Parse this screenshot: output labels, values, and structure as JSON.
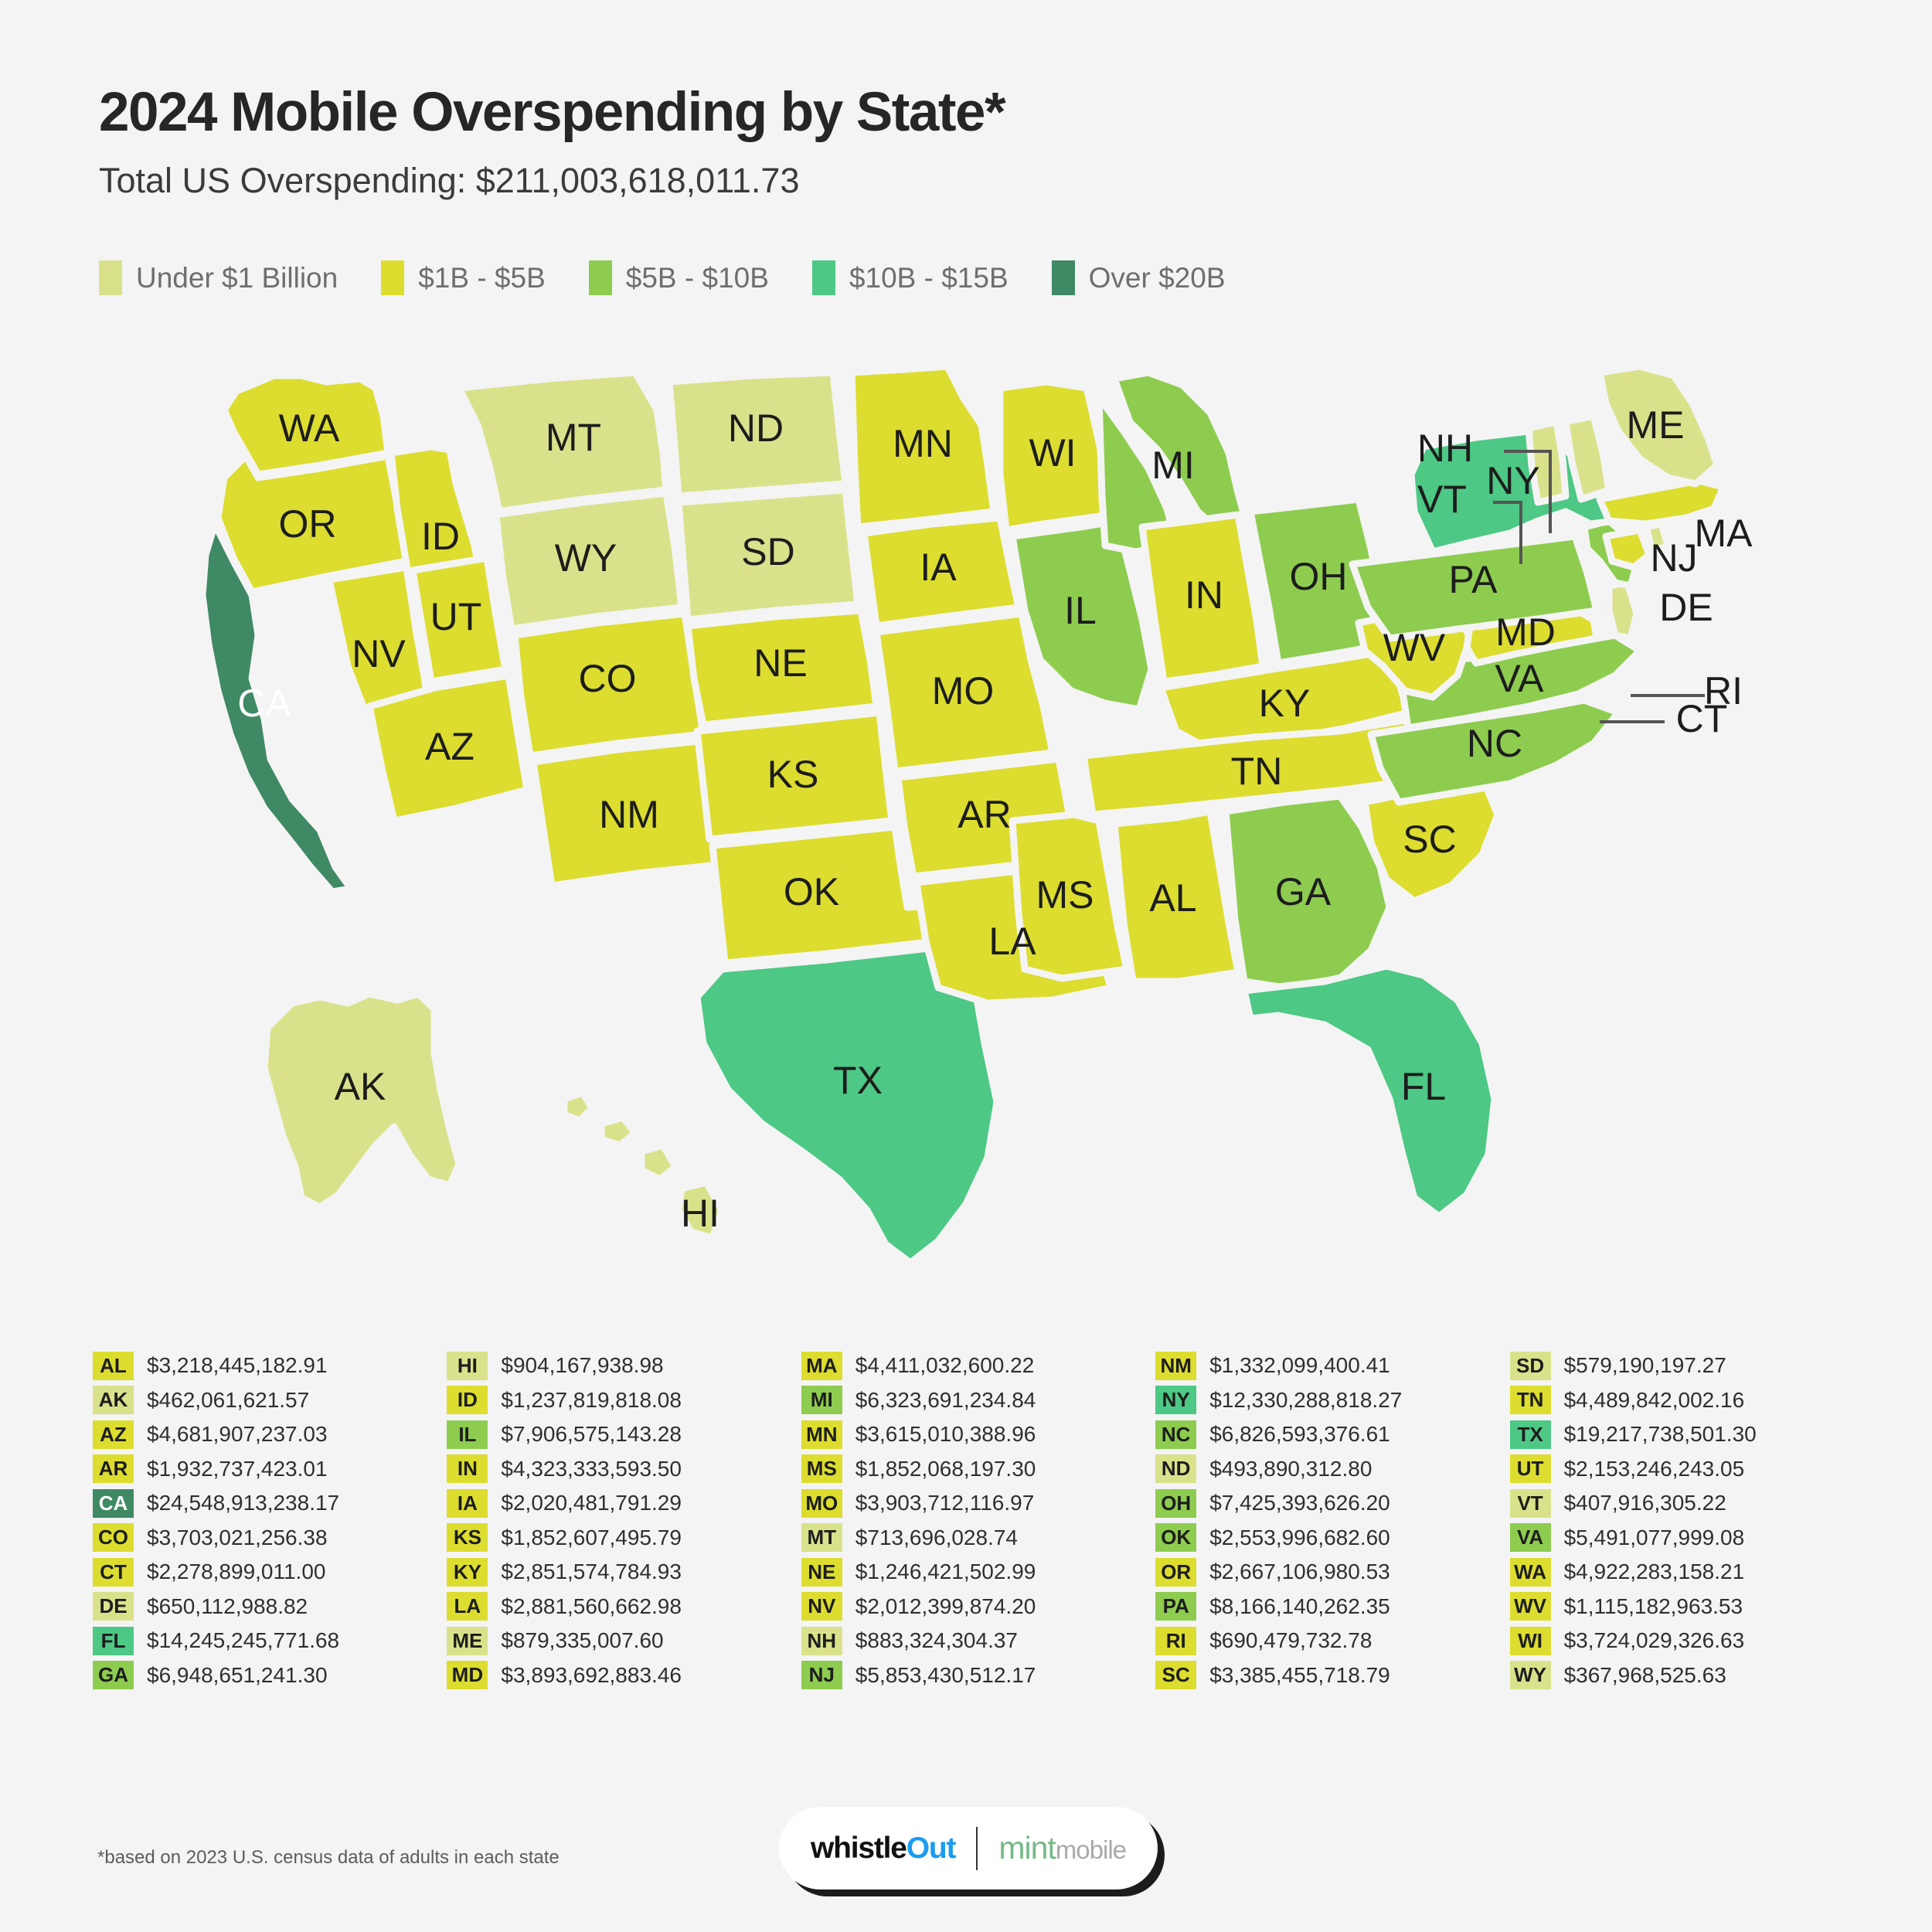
{
  "header": {
    "title": "2024 Mobile Overspending by State*",
    "subtitle": "Total US Overspending: $211,003,618,011.73"
  },
  "legend": {
    "items": [
      {
        "label": "Under $1 Billion",
        "color": "#d9e28b"
      },
      {
        "label": "$1B - $5B",
        "color": "#dcdd2f"
      },
      {
        "label": "$5B - $10B",
        "color": "#8ecc4f"
      },
      {
        "label": "$10B - $15B",
        "color": "#4dc885"
      },
      {
        "label": "Over $20B",
        "color": "#3f8964"
      }
    ]
  },
  "map": {
    "note": "US choropleth of mobile overspending by state",
    "callout_labels": [
      "NH",
      "VT",
      "MA",
      "RI",
      "CT",
      "NJ",
      "DE"
    ],
    "state_labels": [
      "WA",
      "OR",
      "ID",
      "MT",
      "ND",
      "SD",
      "WY",
      "MN",
      "WI",
      "MI",
      "NY",
      "ME",
      "NV",
      "UT",
      "CO",
      "NE",
      "IA",
      "IL",
      "IN",
      "OH",
      "PA",
      "MD",
      "WV",
      "VA",
      "NC",
      "CA",
      "AZ",
      "NM",
      "KS",
      "MO",
      "KY",
      "TN",
      "SC",
      "GA",
      "OK",
      "AR",
      "MS",
      "AL",
      "LA",
      "TX",
      "FL",
      "AK",
      "HI"
    ]
  },
  "chart_data": {
    "type": "choropleth",
    "title": "2024 Mobile Overspending by State",
    "total_label": "Total US Overspending",
    "total_value": "$211,003,618,011.73",
    "unit": "USD",
    "bins": [
      {
        "label": "Under $1 Billion",
        "color": "#d9e28b",
        "min": 0,
        "max": 1000000000
      },
      {
        "label": "$1B - $5B",
        "color": "#dcdd2f",
        "min": 1000000000,
        "max": 5000000000
      },
      {
        "label": "$5B - $10B",
        "color": "#8ecc4f",
        "min": 5000000000,
        "max": 10000000000
      },
      {
        "label": "$10B - $15B",
        "color": "#4dc885",
        "min": 10000000000,
        "max": 15000000000
      },
      {
        "label": "Over $20B",
        "color": "#3f8964",
        "min": 20000000000,
        "max": null
      }
    ],
    "states": {
      "AL": {
        "value": 3218445182.91,
        "label": "$3,218,445,182.91",
        "bin": 1
      },
      "AK": {
        "value": 462061621.57,
        "label": "$462,061,621.57",
        "bin": 0
      },
      "AZ": {
        "value": 4681907237.03,
        "label": "$4,681,907,237.03",
        "bin": 1
      },
      "AR": {
        "value": 1932737423.01,
        "label": "$1,932,737,423.01",
        "bin": 1
      },
      "CA": {
        "value": 24548913238.17,
        "label": "$24,548,913,238.17",
        "bin": 4
      },
      "CO": {
        "value": 3703021256.38,
        "label": "$3,703,021,256.38",
        "bin": 1
      },
      "CT": {
        "value": 2278899011.0,
        "label": "$2,278,899,011.00",
        "bin": 1
      },
      "DE": {
        "value": 650112988.82,
        "label": "$650,112,988.82",
        "bin": 0
      },
      "FL": {
        "value": 14245245771.68,
        "label": "$14,245,245,771.68",
        "bin": 3
      },
      "GA": {
        "value": 6948651241.3,
        "label": "$6,948,651,241.30",
        "bin": 2
      },
      "HI": {
        "value": 904167938.98,
        "label": "$904,167,938.98",
        "bin": 0
      },
      "ID": {
        "value": 1237819818.08,
        "label": "$1,237,819,818.08",
        "bin": 1
      },
      "IL": {
        "value": 7906575143.28,
        "label": "$7,906,575,143.28",
        "bin": 2
      },
      "IN": {
        "value": 4323333593.5,
        "label": "$4,323,333,593.50",
        "bin": 1
      },
      "IA": {
        "value": 2020481791.29,
        "label": "$2,020,481,791.29",
        "bin": 1
      },
      "KS": {
        "value": 1852607495.79,
        "label": "$1,852,607,495.79",
        "bin": 1
      },
      "KY": {
        "value": 2851574784.93,
        "label": "$2,851,574,784.93",
        "bin": 1
      },
      "LA": {
        "value": 2881560662.98,
        "label": "$2,881,560,662.98",
        "bin": 1
      },
      "ME": {
        "value": 879335007.6,
        "label": "$879,335,007.60",
        "bin": 0
      },
      "MD": {
        "value": 3893692883.46,
        "label": "$3,893,692,883.46",
        "bin": 1
      },
      "MA": {
        "value": 4411032600.22,
        "label": "$4,411,032,600.22",
        "bin": 1
      },
      "MI": {
        "value": 6323691234.84,
        "label": "$6,323,691,234.84",
        "bin": 2
      },
      "MN": {
        "value": 3615010388.96,
        "label": "$3,615,010,388.96",
        "bin": 1
      },
      "MS": {
        "value": 1852068197.3,
        "label": "$1,852,068,197.30",
        "bin": 1
      },
      "MO": {
        "value": 3903712116.97,
        "label": "$3,903,712,116.97",
        "bin": 1
      },
      "MT": {
        "value": 713696028.74,
        "label": "$713,696,028.74",
        "bin": 0
      },
      "NE": {
        "value": 1246421502.99,
        "label": "$1,246,421,502.99",
        "bin": 1
      },
      "NV": {
        "value": 2012399874.2,
        "label": "$2,012,399,874.20",
        "bin": 1
      },
      "NH": {
        "value": 883324304.37,
        "label": "$883,324,304.37",
        "bin": 0
      },
      "NJ": {
        "value": 5853430512.17,
        "label": "$5,853,430,512.17",
        "bin": 2
      },
      "NM": {
        "value": 1332099400.41,
        "label": "$1,332,099,400.41",
        "bin": 1
      },
      "NY": {
        "value": 12330288818.27,
        "label": "$12,330,288,818.27",
        "bin": 3
      },
      "NC": {
        "value": 6826593376.61,
        "label": "$6,826,593,376.61",
        "bin": 2
      },
      "ND": {
        "value": 493890312.8,
        "label": "$493,890,312.80",
        "bin": 0
      },
      "OH": {
        "value": 7425393626.2,
        "label": "$7,425,393,626.20",
        "bin": 2
      },
      "OK": {
        "value": 2553996682.6,
        "label": "$2,553,996,682.60",
        "bin": 1
      },
      "OR": {
        "value": 2667106980.53,
        "label": "$2,667,106,980.53",
        "bin": 1
      },
      "PA": {
        "value": 8166140262.35,
        "label": "$8,166,140,262.35",
        "bin": 2
      },
      "RI": {
        "value": 690479732.78,
        "label": "$690,479,732.78",
        "bin": 0
      },
      "SC": {
        "value": 3385455718.79,
        "label": "$3,385,455,718.79",
        "bin": 1
      },
      "SD": {
        "value": 579190197.27,
        "label": "$579,190,197.27",
        "bin": 0
      },
      "TN": {
        "value": 4489842002.16,
        "label": "$4,489,842,002.16",
        "bin": 1
      },
      "TX": {
        "value": 19217738501.3,
        "label": "$19,217,738,501.30",
        "bin": 3
      },
      "UT": {
        "value": 2153246243.05,
        "label": "$2,153,246,243.05",
        "bin": 1
      },
      "VT": {
        "value": 407916305.22,
        "label": "$407,916,305.22",
        "bin": 0
      },
      "VA": {
        "value": 5491077999.08,
        "label": "$5,491,077,999.08",
        "bin": 2
      },
      "WA": {
        "value": 4922283158.21,
        "label": "$4,922,283,158.21",
        "bin": 1
      },
      "WV": {
        "value": 1115182963.53,
        "label": "$1,115,182,963.53",
        "bin": 1
      },
      "WI": {
        "value": 3724029326.63,
        "label": "$3,724,029,326.63",
        "bin": 1
      },
      "WY": {
        "value": 367968525.63,
        "label": "$367,968,525.63",
        "bin": 0
      }
    }
  },
  "table": {
    "columns": [
      [
        {
          "state": "AL",
          "value": "$3,218,445,182.91",
          "color": "#dcdd2f"
        },
        {
          "state": "AK",
          "value": "$462,061,621.57",
          "color": "#d9e28b"
        },
        {
          "state": "AZ",
          "value": "$4,681,907,237.03",
          "color": "#dcdd2f"
        },
        {
          "state": "AR",
          "value": "$1,932,737,423.01",
          "color": "#dcdd2f"
        },
        {
          "state": "CA",
          "value": "$24,548,913,238.17",
          "color": "#3f8964",
          "lightText": true
        },
        {
          "state": "CO",
          "value": "$3,703,021,256.38",
          "color": "#dcdd2f"
        },
        {
          "state": "CT",
          "value": "$2,278,899,011.00",
          "color": "#dcdd2f"
        },
        {
          "state": "DE",
          "value": "$650,112,988.82",
          "color": "#d9e28b"
        },
        {
          "state": "FL",
          "value": "$14,245,245,771.68",
          "color": "#4dc885"
        },
        {
          "state": "GA",
          "value": "$6,948,651,241.30",
          "color": "#8ecc4f"
        }
      ],
      [
        {
          "state": "HI",
          "value": "$904,167,938.98",
          "color": "#d9e28b"
        },
        {
          "state": "ID",
          "value": "$1,237,819,818.08",
          "color": "#dcdd2f"
        },
        {
          "state": "IL",
          "value": "$7,906,575,143.28",
          "color": "#8ecc4f"
        },
        {
          "state": "IN",
          "value": "$4,323,333,593.50",
          "color": "#dcdd2f"
        },
        {
          "state": "IA",
          "value": "$2,020,481,791.29",
          "color": "#dcdd2f"
        },
        {
          "state": "KS",
          "value": "$1,852,607,495.79",
          "color": "#dcdd2f"
        },
        {
          "state": "KY",
          "value": "$2,851,574,784.93",
          "color": "#dcdd2f"
        },
        {
          "state": "LA",
          "value": "$2,881,560,662.98",
          "color": "#dcdd2f"
        },
        {
          "state": "ME",
          "value": "$879,335,007.60",
          "color": "#d9e28b"
        },
        {
          "state": "MD",
          "value": "$3,893,692,883.46",
          "color": "#dcdd2f"
        }
      ],
      [
        {
          "state": "MA",
          "value": "$4,411,032,600.22",
          "color": "#dcdd2f"
        },
        {
          "state": "MI",
          "value": "$6,323,691,234.84",
          "color": "#8ecc4f"
        },
        {
          "state": "MN",
          "value": "$3,615,010,388.96",
          "color": "#dcdd2f"
        },
        {
          "state": "MS",
          "value": "$1,852,068,197.30",
          "color": "#dcdd2f"
        },
        {
          "state": "MO",
          "value": "$3,903,712,116.97",
          "color": "#dcdd2f"
        },
        {
          "state": "MT",
          "value": "$713,696,028.74",
          "color": "#d9e28b"
        },
        {
          "state": "NE",
          "value": "$1,246,421,502.99",
          "color": "#dcdd2f"
        },
        {
          "state": "NV",
          "value": "$2,012,399,874.20",
          "color": "#dcdd2f"
        },
        {
          "state": "NH",
          "value": "$883,324,304.37",
          "color": "#d9e28b"
        },
        {
          "state": "NJ",
          "value": "$5,853,430,512.17",
          "color": "#8ecc4f"
        }
      ],
      [
        {
          "state": "NM",
          "value": "$1,332,099,400.41",
          "color": "#dcdd2f"
        },
        {
          "state": "NY",
          "value": "$12,330,288,818.27",
          "color": "#4dc885"
        },
        {
          "state": "NC",
          "value": "$6,826,593,376.61",
          "color": "#8ecc4f"
        },
        {
          "state": "ND",
          "value": "$493,890,312.80",
          "color": "#d9e28b"
        },
        {
          "state": "OH",
          "value": "$7,425,393,626.20",
          "color": "#8ecc4f"
        },
        {
          "state": "OK",
          "value": "$2,553,996,682.60",
          "color": "#8ecc4f"
        },
        {
          "state": "OR",
          "value": "$2,667,106,980.53",
          "color": "#dcdd2f"
        },
        {
          "state": "PA",
          "value": "$8,166,140,262.35",
          "color": "#8ecc4f"
        },
        {
          "state": "RI",
          "value": "$690,479,732.78",
          "color": "#dcdd2f"
        },
        {
          "state": "SC",
          "value": "$3,385,455,718.79",
          "color": "#dcdd2f"
        }
      ],
      [
        {
          "state": "SD",
          "value": "$579,190,197.27",
          "color": "#d9e28b"
        },
        {
          "state": "TN",
          "value": "$4,489,842,002.16",
          "color": "#dcdd2f"
        },
        {
          "state": "TX",
          "value": "$19,217,738,501.30",
          "color": "#4dc885"
        },
        {
          "state": "UT",
          "value": "$2,153,246,243.05",
          "color": "#dcdd2f"
        },
        {
          "state": "VT",
          "value": "$407,916,305.22",
          "color": "#d9e28b"
        },
        {
          "state": "VA",
          "value": "$5,491,077,999.08",
          "color": "#8ecc4f"
        },
        {
          "state": "WA",
          "value": "$4,922,283,158.21",
          "color": "#dcdd2f"
        },
        {
          "state": "WV",
          "value": "$1,115,182,963.53",
          "color": "#dcdd2f"
        },
        {
          "state": "WI",
          "value": "$3,724,029,326.63",
          "color": "#dcdd2f"
        },
        {
          "state": "WY",
          "value": "$367,968,525.63",
          "color": "#d9e28b"
        }
      ]
    ]
  },
  "footer": {
    "footnote": "*based on 2023 U.S. census data of adults in each state",
    "logo_whistle": "whistle",
    "logo_out": "Out",
    "logo_mint": "mint",
    "logo_mobile": "mobile"
  }
}
